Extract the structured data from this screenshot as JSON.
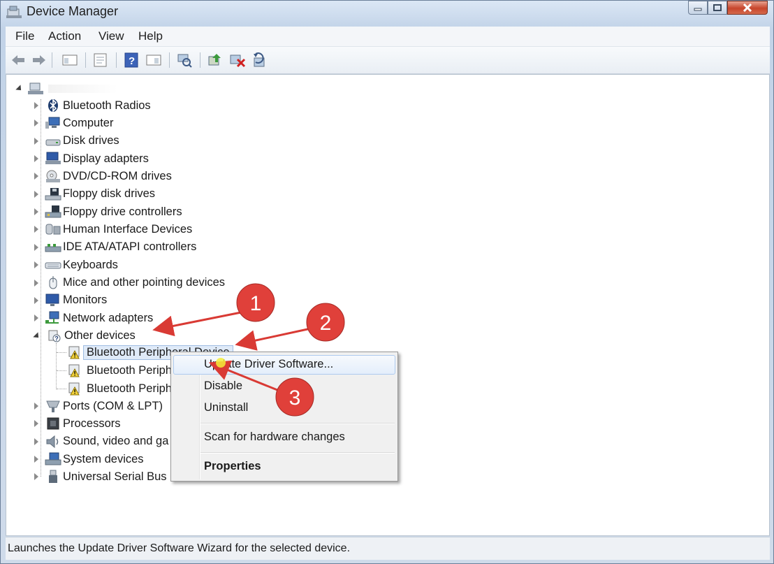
{
  "window": {
    "title": "Device Manager"
  },
  "menubar": {
    "file": "File",
    "action": "Action",
    "view": "View",
    "help": "Help"
  },
  "toolbar": {
    "icons": [
      "back-arrow-icon",
      "forward-arrow-icon",
      "console-tree-icon",
      "properties-icon",
      "help-icon",
      "show-hide-icon",
      "scan-hardware-icon",
      "update-driver-icon",
      "uninstall-icon",
      "rollback-icon"
    ]
  },
  "tree": {
    "categories": [
      {
        "label": "Bluetooth Radios",
        "icon": "bluetooth-icon"
      },
      {
        "label": "Computer",
        "icon": "computer-icon"
      },
      {
        "label": "Disk drives",
        "icon": "disk-drive-icon"
      },
      {
        "label": "Display adapters",
        "icon": "display-adapter-icon"
      },
      {
        "label": "DVD/CD-ROM drives",
        "icon": "dvd-drive-icon"
      },
      {
        "label": "Floppy disk drives",
        "icon": "floppy-disk-icon"
      },
      {
        "label": "Floppy drive controllers",
        "icon": "floppy-controller-icon"
      },
      {
        "label": "Human Interface Devices",
        "icon": "hid-icon"
      },
      {
        "label": "IDE ATA/ATAPI controllers",
        "icon": "ide-controller-icon"
      },
      {
        "label": "Keyboards",
        "icon": "keyboard-icon"
      },
      {
        "label": "Mice and other pointing devices",
        "icon": "mouse-icon"
      },
      {
        "label": "Monitors",
        "icon": "monitor-icon"
      },
      {
        "label": "Network adapters",
        "icon": "network-adapter-icon"
      },
      {
        "label": "Other devices",
        "icon": "unknown-device-icon"
      }
    ],
    "other_children": [
      "Bluetooth Peripheral Device",
      "Bluetooth Periph",
      "Bluetooth Periph"
    ],
    "categories_after": [
      {
        "label": "Ports (COM & LPT)",
        "icon": "port-icon"
      },
      {
        "label": "Processors",
        "icon": "processor-icon"
      },
      {
        "label": "Sound, video and ga",
        "icon": "sound-icon"
      },
      {
        "label": "System devices",
        "icon": "system-device-icon"
      },
      {
        "label": "Universal Serial Bus",
        "icon": "usb-icon"
      }
    ]
  },
  "context_menu": {
    "update": "Update Driver Software...",
    "disable": "Disable",
    "uninstall": "Uninstall",
    "scan": "Scan for hardware changes",
    "properties": "Properties"
  },
  "annotations": {
    "one": "1",
    "two": "2",
    "three": "3",
    "color": "#e0403a"
  },
  "status": {
    "text": "Launches the Update Driver Software Wizard for the selected device."
  }
}
